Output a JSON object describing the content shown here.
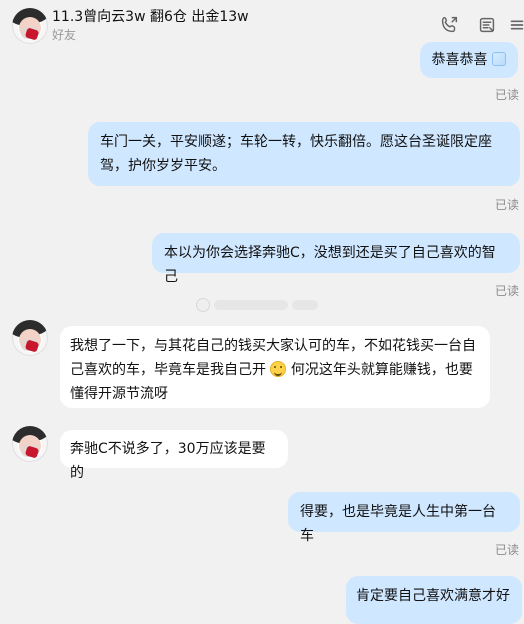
{
  "header": {
    "title": "11.3曾向云3w 翻6仓 出金13w",
    "subtitle": "好友"
  },
  "icons": {
    "call": "phone-icon",
    "notes": "notes-icon",
    "more": "more-icon"
  },
  "messages": [
    {
      "side": "right",
      "text": "恭喜恭喜",
      "read": "已读"
    },
    {
      "side": "right",
      "text": "车门一关，平安顺遂；车轮一转，快乐翻倍。愿这台圣诞限定座驾，护你岁岁平安。",
      "read": "已读"
    },
    {
      "side": "right",
      "text": "本以为你会选择奔驰C，没想到还是买了自己喜欢的智己",
      "read": "已读"
    },
    {
      "side": "left",
      "text_a": "我想了一下，与其花自己的钱买大家认可的车，不如花钱买一台自己喜欢的车，毕竟车是我自己开",
      "text_b": "何况这年头就算能赚钱，也要懂得开源节流呀"
    },
    {
      "side": "left",
      "text": "奔驰C不说多了，30万应该是要的"
    },
    {
      "side": "right",
      "text": "得要，也是毕竟是人生中第一台车",
      "read": "已读"
    },
    {
      "side": "right",
      "text": "肯定要自己喜欢满意才好"
    }
  ]
}
